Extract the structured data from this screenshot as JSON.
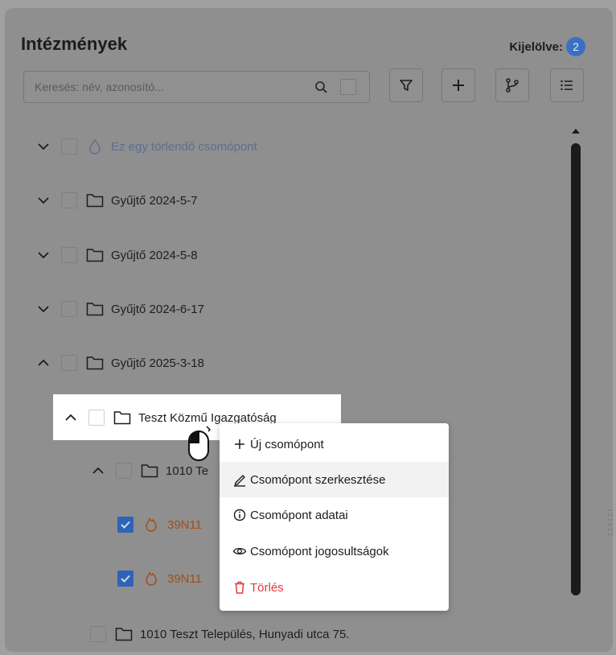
{
  "header": {
    "title": "Intézmények",
    "selected_label": "Kijelölve:",
    "selected_count": "2"
  },
  "search": {
    "placeholder": "Keresés: név, azonosító..."
  },
  "toolbar": {
    "icons": [
      "filter-icon",
      "plus-icon",
      "branch-icon",
      "list-icon"
    ]
  },
  "tree": {
    "items": [
      {
        "label": "Ez egy törlendő csomópont",
        "icon": "droplet-icon",
        "expanded": false,
        "state": "deleted"
      },
      {
        "label": "Gyűjtő 2024-5-7",
        "icon": "folder-icon",
        "expanded": false
      },
      {
        "label": "Gyűjtő 2024-5-8",
        "icon": "folder-icon",
        "expanded": false
      },
      {
        "label": "Gyűjtő 2024-6-17",
        "icon": "folder-icon",
        "expanded": false
      },
      {
        "label": "Gyűjtő 2025-3-18",
        "icon": "folder-icon",
        "expanded": true
      },
      {
        "label": "Teszt Közmű Igazgatóság",
        "icon": "folder-icon",
        "expanded": true,
        "highlighted": true
      },
      {
        "label": "1010 Te",
        "icon": "folder-icon",
        "expanded": true
      },
      {
        "label": "39N11",
        "icon": "flame-icon",
        "checked": true
      },
      {
        "label": "39N11",
        "icon": "flame-icon",
        "checked": true
      },
      {
        "label": "1010 Teszt Település, Hunyadi utca 75.",
        "icon": "folder-icon"
      }
    ]
  },
  "context_menu": {
    "items": [
      {
        "label": "Új csomópont",
        "icon": "plus-icon"
      },
      {
        "label": "Csomópont szerkesztése",
        "icon": "pencil-icon"
      },
      {
        "label": "Csomópont adatai",
        "icon": "info-icon"
      },
      {
        "label": "Csomópont jogosultságok",
        "icon": "eye-icon"
      },
      {
        "label": "Törlés",
        "icon": "trash-icon"
      }
    ]
  },
  "colors": {
    "accent": "#2e63b8",
    "danger": "#e33b3b",
    "orange": "#a24e17"
  }
}
